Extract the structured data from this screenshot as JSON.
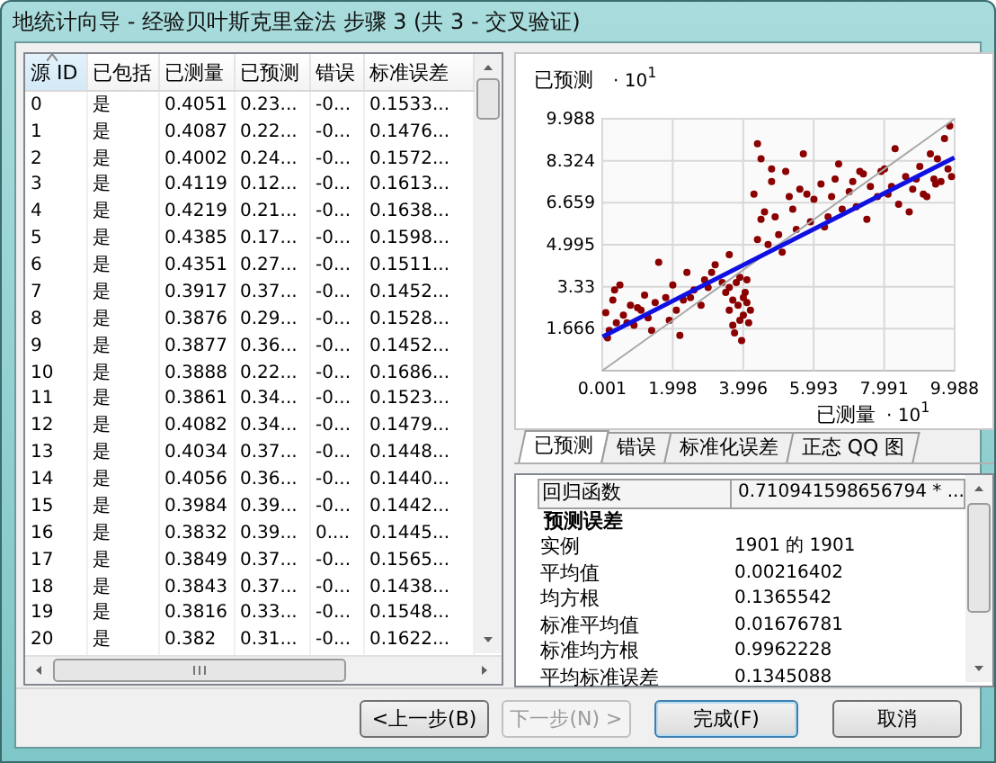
{
  "window": {
    "title": "地统计向导 - 经验贝叶斯克里金法 步骤 3 (共 3 - 交叉验证)"
  },
  "table": {
    "columns": [
      {
        "label": "源 ID",
        "sorted": true
      },
      {
        "label": "已包括",
        "sorted": false
      },
      {
        "label": "已测量",
        "sorted": false
      },
      {
        "label": "已预测",
        "sorted": false
      },
      {
        "label": "错误",
        "sorted": false
      },
      {
        "label": "标准误差",
        "sorted": false
      }
    ],
    "rows": [
      [
        "0",
        "是",
        "0.4051",
        "0.23...",
        "-0...",
        "0.1533..."
      ],
      [
        "1",
        "是",
        "0.4087",
        "0.22...",
        "-0...",
        "0.1476..."
      ],
      [
        "2",
        "是",
        "0.4002",
        "0.24...",
        "-0...",
        "0.1572..."
      ],
      [
        "3",
        "是",
        "0.4119",
        "0.12...",
        "-0...",
        "0.1613..."
      ],
      [
        "4",
        "是",
        "0.4219",
        "0.21...",
        "-0...",
        "0.1638..."
      ],
      [
        "5",
        "是",
        "0.4385",
        "0.17...",
        "-0...",
        "0.1598..."
      ],
      [
        "6",
        "是",
        "0.4351",
        "0.27...",
        "-0...",
        "0.1511..."
      ],
      [
        "7",
        "是",
        "0.3917",
        "0.37...",
        "-0...",
        "0.1452..."
      ],
      [
        "8",
        "是",
        "0.3876",
        "0.29...",
        "-0...",
        "0.1528..."
      ],
      [
        "9",
        "是",
        "0.3877",
        "0.36...",
        "-0...",
        "0.1452..."
      ],
      [
        "10",
        "是",
        "0.3888",
        "0.22...",
        "-0...",
        "0.1686..."
      ],
      [
        "11",
        "是",
        "0.3861",
        "0.34...",
        "-0...",
        "0.1523..."
      ],
      [
        "12",
        "是",
        "0.4082",
        "0.34...",
        "-0...",
        "0.1479..."
      ],
      [
        "13",
        "是",
        "0.4034",
        "0.37...",
        "-0...",
        "0.1448..."
      ],
      [
        "14",
        "是",
        "0.4056",
        "0.36...",
        "-0...",
        "0.1440..."
      ],
      [
        "15",
        "是",
        "0.3984",
        "0.39...",
        "-0...",
        "0.1442..."
      ],
      [
        "16",
        "是",
        "0.3832",
        "0.39...",
        "0....",
        "0.1445..."
      ],
      [
        "17",
        "是",
        "0.3849",
        "0.37...",
        "-0...",
        "0.1565..."
      ],
      [
        "18",
        "是",
        "0.3843",
        "0.37...",
        "-0...",
        "0.1438..."
      ],
      [
        "19",
        "是",
        "0.3816",
        "0.33...",
        "-0...",
        "0.1548..."
      ],
      [
        "20",
        "是",
        "0.382",
        "0.31...",
        "-0...",
        "0.1622..."
      ]
    ]
  },
  "chart": {
    "y_multiplier": "· 10",
    "y_exponent": "1",
    "x_multiplier": "· 10",
    "x_exponent": "1",
    "chart_data": {
      "type": "scatter",
      "grid": true,
      "xlabel": "已测量",
      "ylabel": "已预测",
      "xlim": [
        0.001,
        9.988
      ],
      "ylim": [
        0.001,
        9.988
      ],
      "xticks": [
        {
          "value": 0.001,
          "label": "0.001"
        },
        {
          "value": 1.998,
          "label": "1.998"
        },
        {
          "value": 3.996,
          "label": "3.996"
        },
        {
          "value": 5.993,
          "label": "5.993"
        },
        {
          "value": 7.991,
          "label": "7.991"
        },
        {
          "value": 9.988,
          "label": "9.988"
        }
      ],
      "yticks": [
        {
          "value": 1.666,
          "label": "1.666"
        },
        {
          "value": 3.33,
          "label": "3.33"
        },
        {
          "value": 4.995,
          "label": "4.995"
        },
        {
          "value": 6.659,
          "label": "6.659"
        },
        {
          "value": 8.324,
          "label": "8.324"
        },
        {
          "value": 9.988,
          "label": "9.988"
        }
      ],
      "series": [
        {
          "type": "scatter",
          "color": "#8b0000",
          "x": [
            0.1,
            0.2,
            0.3,
            0.4,
            0.5,
            0.6,
            0.8,
            0.9,
            1.0,
            1.2,
            1.3,
            1.5,
            1.6,
            1.8,
            2.0,
            2.1,
            2.3,
            2.4,
            2.6,
            2.8,
            2.9,
            3.0,
            3.2,
            3.4,
            0.15,
            0.35,
            0.7,
            1.1,
            1.4,
            1.9,
            2.2,
            2.5,
            3.1,
            3.6,
            3.5,
            3.6,
            3.7,
            3.8,
            3.9,
            4.0,
            4.1,
            4.2,
            3.6,
            3.75,
            3.85,
            3.95,
            4.05,
            4.15,
            3.7,
            3.9,
            4.0,
            4.1,
            4.3,
            4.4,
            4.5,
            4.6,
            4.7,
            4.8,
            4.9,
            5.0,
            5.2,
            5.4,
            5.5,
            5.7,
            5.9,
            6.0,
            6.2,
            6.4,
            6.6,
            6.8,
            7.0,
            7.2,
            7.4,
            7.6,
            7.8,
            8.0,
            8.2,
            8.4,
            8.6,
            8.8,
            9.0,
            9.2,
            9.4,
            9.5,
            9.6,
            9.7,
            9.8,
            9.9,
            4.5,
            4.8,
            5.1,
            5.3,
            5.8,
            6.3,
            6.7,
            7.1,
            7.5,
            7.9,
            8.3,
            8.7,
            9.1,
            9.3,
            9.85,
            4.4,
            5.6,
            6.5,
            7.3,
            8.1,
            8.9,
            9.45
          ],
          "values": [
            2.3,
            1.6,
            2.8,
            1.9,
            3.4,
            2.2,
            2.6,
            1.8,
            2.5,
            3.0,
            2.1,
            2.7,
            4.3,
            2.9,
            3.4,
            2.4,
            2.8,
            3.9,
            3.2,
            2.6,
            3.6,
            3.3,
            4.2,
            3.5,
            1.3,
            3.2,
            1.9,
            2.4,
            1.6,
            2.0,
            1.4,
            2.9,
            3.9,
            4.6,
            3.1,
            2.4,
            1.8,
            3.5,
            2.0,
            2.9,
            3.6,
            2.4,
            3.3,
            1.5,
            2.6,
            1.2,
            3.1,
            1.9,
            2.8,
            3.7,
            2.2,
            2.7,
            7.0,
            5.2,
            8.4,
            6.3,
            5.0,
            7.5,
            6.1,
            5.4,
            7.9,
            6.4,
            5.6,
            8.6,
            5.9,
            6.8,
            7.4,
            6.1,
            7.6,
            6.4,
            7.1,
            6.5,
            7.8,
            7.3,
            6.9,
            8.0,
            7.3,
            6.6,
            7.7,
            7.2,
            8.1,
            6.9,
            7.6,
            8.4,
            7.5,
            9.2,
            8.0,
            7.7,
            6.0,
            8.0,
            4.7,
            6.9,
            7.0,
            5.7,
            8.2,
            7.5,
            6.0,
            7.9,
            8.8,
            6.3,
            7.0,
            8.6,
            9.7,
            9.0,
            7.2,
            6.9,
            7.9,
            7.0,
            7.6,
            7.4
          ]
        },
        {
          "type": "line",
          "color": "#a8a8a8",
          "x": [
            0.01,
            9.98
          ],
          "values": [
            0.01,
            9.98
          ]
        },
        {
          "type": "line",
          "color": "#1010e0",
          "x": [
            0.01,
            9.98
          ],
          "values": [
            1.35,
            8.45
          ]
        }
      ]
    }
  },
  "tabs": [
    {
      "label": "已预测",
      "selected": true
    },
    {
      "label": "错误",
      "selected": false
    },
    {
      "label": "标准化误差",
      "selected": false
    },
    {
      "label": "正态 QQ 图",
      "selected": false
    }
  ],
  "stats": [
    {
      "kind": "header",
      "name": "回归函数",
      "value": "0.710941598656794 * ..."
    },
    {
      "kind": "group",
      "name": "预测误差"
    },
    {
      "kind": "row",
      "name": "实例",
      "value": "1901 的 1901"
    },
    {
      "kind": "row",
      "name": "平均值",
      "value": "0.00216402"
    },
    {
      "kind": "row",
      "name": "均方根",
      "value": "0.1365542"
    },
    {
      "kind": "row",
      "name": "标准平均值",
      "value": "0.01676781"
    },
    {
      "kind": "row",
      "name": "标准均方根",
      "value": "0.9962228"
    },
    {
      "kind": "row",
      "name": "平均标准误差",
      "value": "0.1345088"
    }
  ],
  "buttons": [
    {
      "label": "<上一步(B)",
      "disabled": false,
      "default": false
    },
    {
      "label": "下一步(N) >",
      "disabled": true,
      "default": false
    },
    {
      "label": "完成(F)",
      "disabled": false,
      "default": true
    },
    {
      "label": "取消",
      "disabled": false,
      "default": false
    }
  ]
}
